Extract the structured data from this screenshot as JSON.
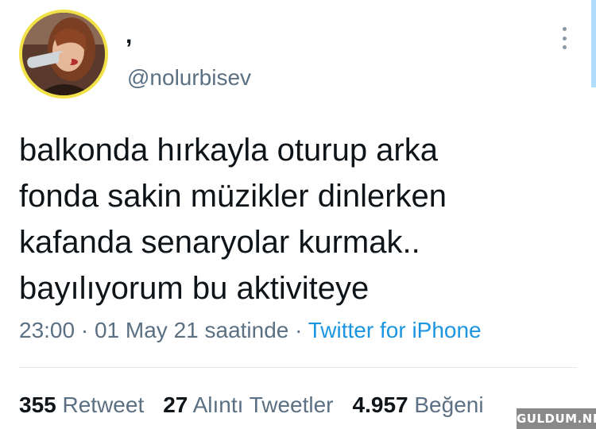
{
  "user": {
    "display_name": ",",
    "handle": "@nolurbisev"
  },
  "tweet": {
    "lines": [
      "balkonda hırkayla oturup arka",
      "fonda sakin müzikler dinlerken",
      "kafanda senaryolar kurmak..",
      "bayılıyorum bu aktiviteye"
    ],
    "time": "23:00",
    "date_text": "01 May 21 saatinde",
    "separator": "·",
    "source": "Twitter for iPhone"
  },
  "stats": {
    "retweets_count": "355",
    "retweets_label": "Retweet",
    "quotes_count": "27",
    "quotes_label": "Alıntı Tweetler",
    "likes_count": "4.957",
    "likes_label": "Beğeni"
  },
  "watermark": "GULDUM.NET",
  "icons": {
    "more": "more-vertical-icon",
    "avatar": "profile-photo"
  },
  "colors": {
    "text": "#0f1419",
    "secondary": "#5b7083",
    "link": "#1b95e0",
    "avatar_ring": "#f2e24a"
  }
}
